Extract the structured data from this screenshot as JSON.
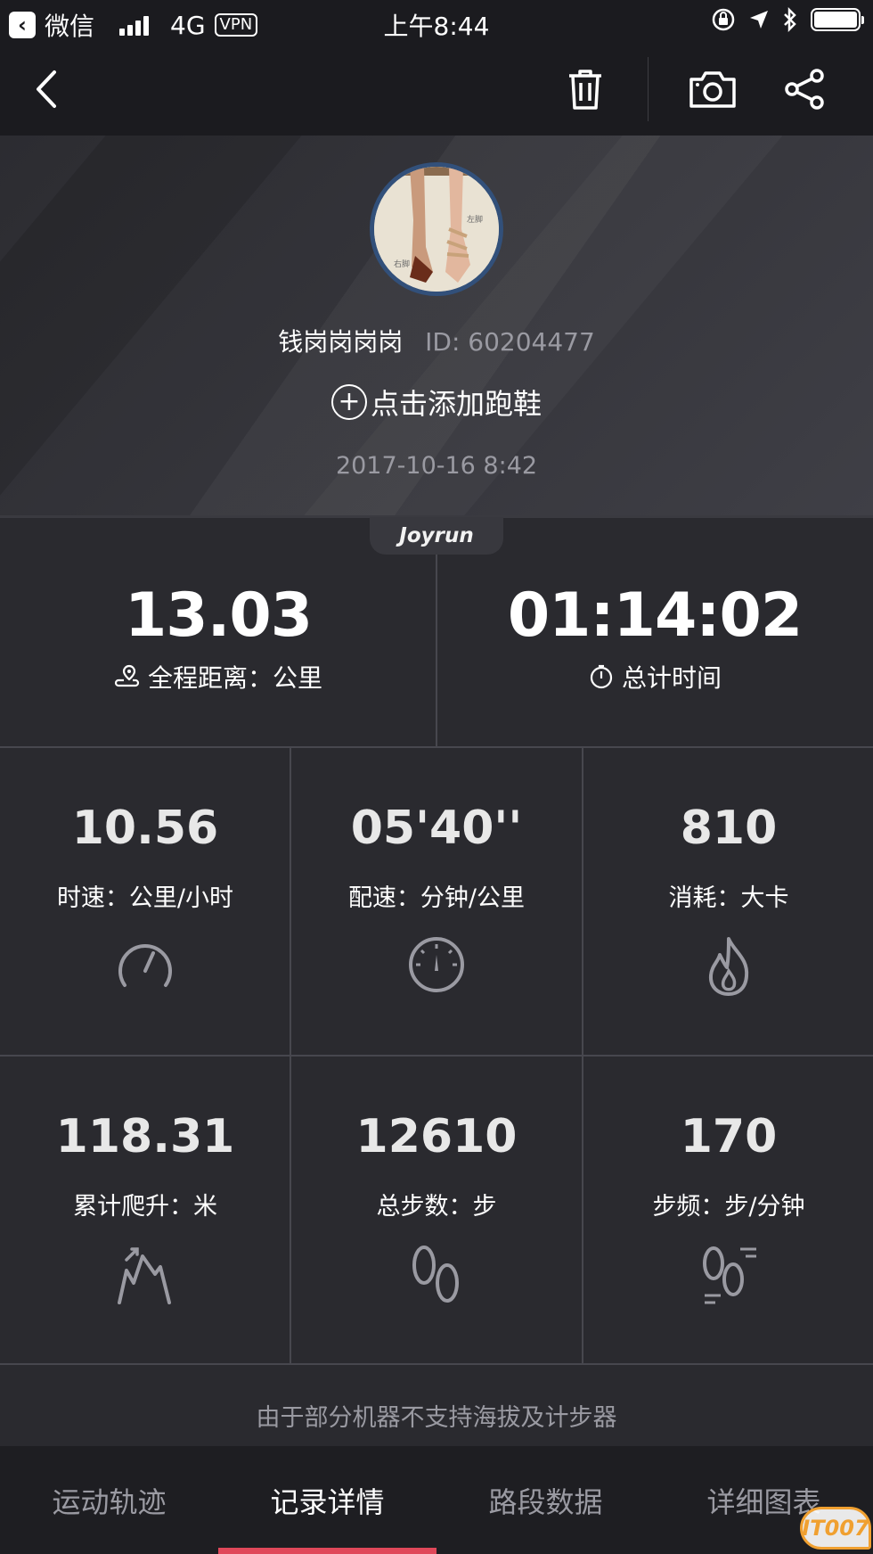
{
  "status_bar": {
    "back_app": "微信",
    "network": "4G",
    "vpn": "VPN",
    "time": "上午8:44"
  },
  "nav": {
    "back": "back-icon",
    "delete": "trash-icon",
    "camera": "camera-icon",
    "share": "share-icon"
  },
  "profile": {
    "username": "钱岗岗岗岗",
    "user_id": "ID: 60204477",
    "add_shoes": "点击添加跑鞋",
    "datetime": "2017-10-16 8:42"
  },
  "brand": "Joyrun",
  "main_stats": [
    {
      "value": "13.03",
      "label": "全程距离：公里",
      "icon": "route-pin-icon"
    },
    {
      "value": "01:14:02",
      "label": "总计时间",
      "icon": "stopwatch-icon"
    }
  ],
  "grid_stats": [
    {
      "value": "10.56",
      "label": "时速：公里/小时",
      "icon": "speedometer-icon"
    },
    {
      "value": "05'40''",
      "label": "配速：分钟/公里",
      "icon": "pace-dial-icon"
    },
    {
      "value": "810",
      "label": "消耗：大卡",
      "icon": "flame-icon"
    },
    {
      "value": "118.31",
      "label": "累计爬升：米",
      "icon": "climb-icon"
    },
    {
      "value": "12610",
      "label": "总步数：步",
      "icon": "footprints-icon"
    },
    {
      "value": "170",
      "label": "步频：步/分钟",
      "icon": "cadence-icon"
    }
  ],
  "note": "由于部分机器不支持海拔及计步器",
  "tabs": [
    {
      "label": "运动轨迹"
    },
    {
      "label": "记录详情"
    },
    {
      "label": "路段数据"
    },
    {
      "label": "详细图表"
    }
  ],
  "active_tab": "记录详情",
  "watermark": "IT007",
  "colors": {
    "background": "#2a2a2f",
    "bar": "#1b1b1f",
    "tab_indicator": "#e0485a",
    "avatar_ring": "#32507a"
  }
}
